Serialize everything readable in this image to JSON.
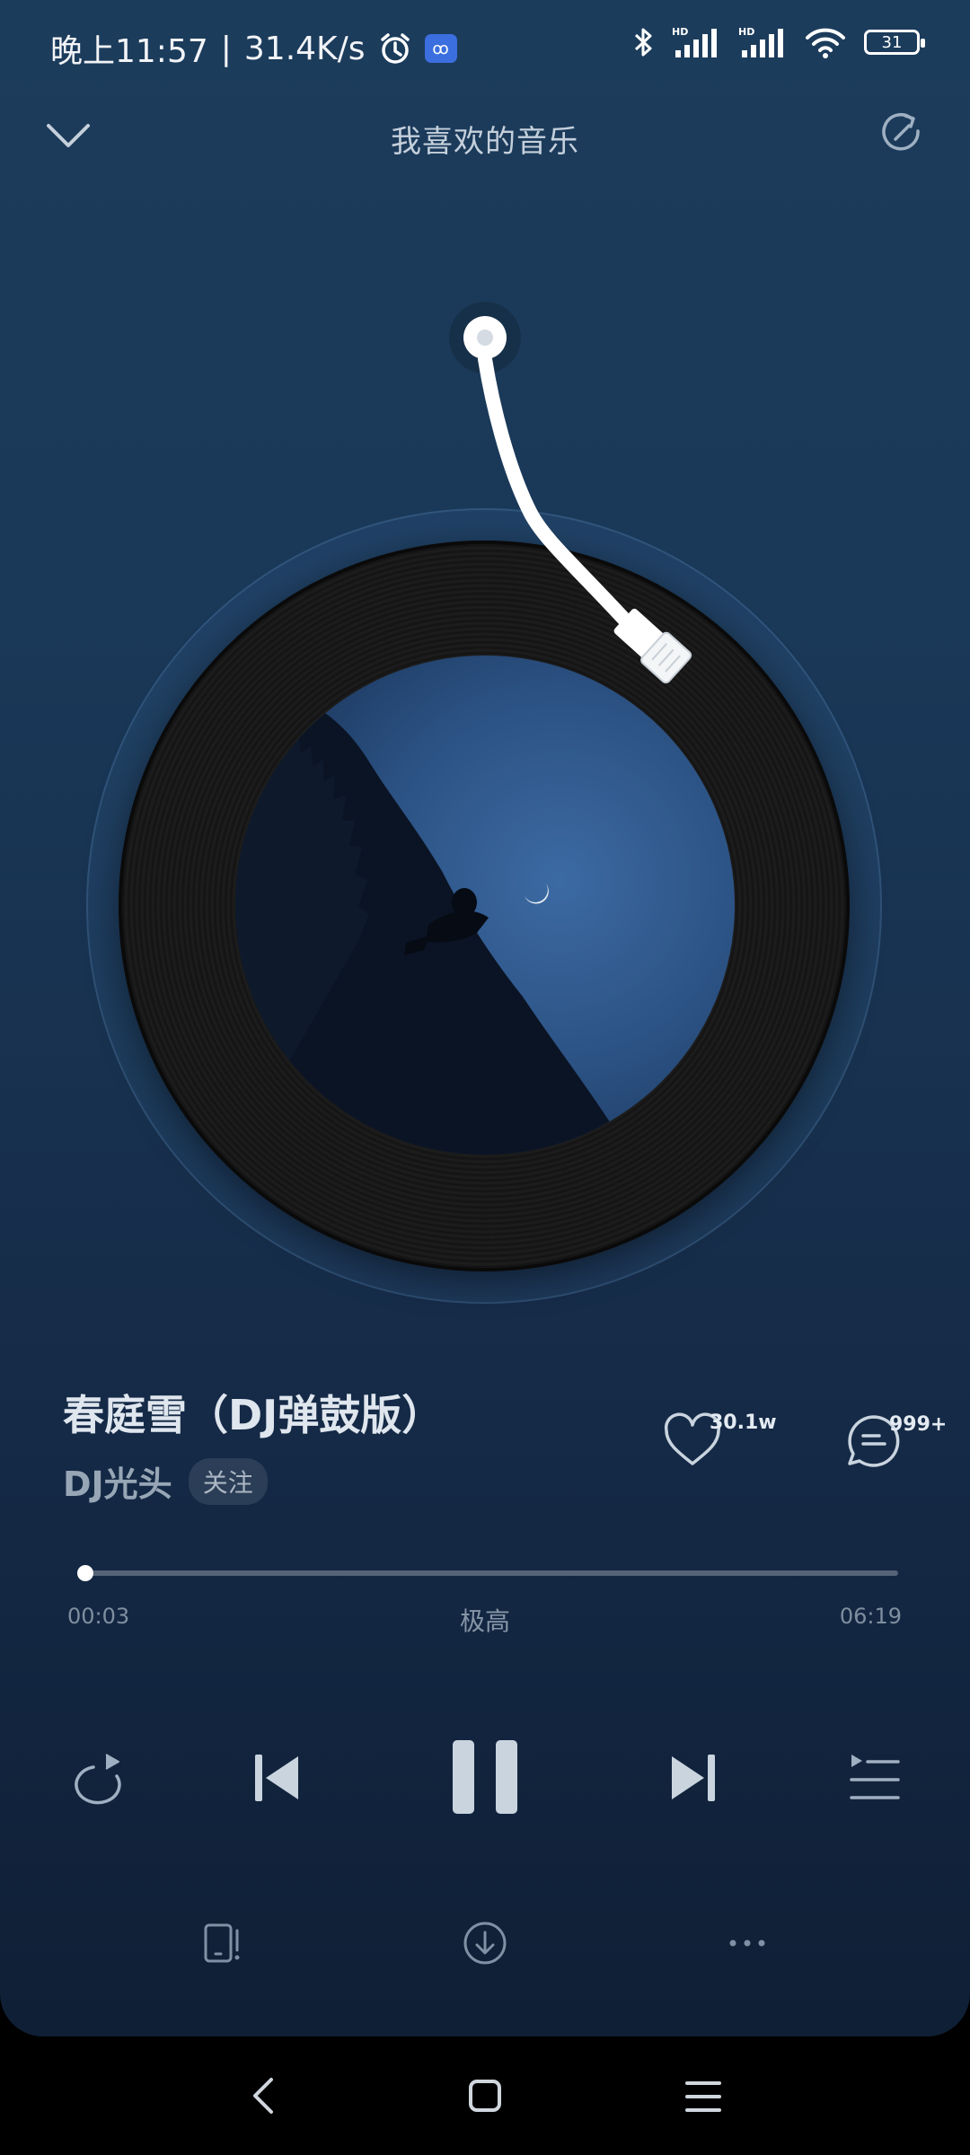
{
  "status": {
    "time": "晚上11:57",
    "speed": "31.4K/s",
    "app_badge": "ꝏ",
    "battery": "31"
  },
  "header": {
    "title": "我喜欢的音乐"
  },
  "song": {
    "title": "春庭雪（DJ弹鼓版）",
    "artist": "DJ光头",
    "follow_label": "关注",
    "likes": "30.1w",
    "comments": "999+"
  },
  "playback": {
    "current": "00:03",
    "quality": "极高",
    "total": "06:19",
    "progress": 0.008
  },
  "colors": {
    "accent": "#e8eef4",
    "background_top": "#1c3c5c",
    "background_bottom": "#0f1f35"
  }
}
